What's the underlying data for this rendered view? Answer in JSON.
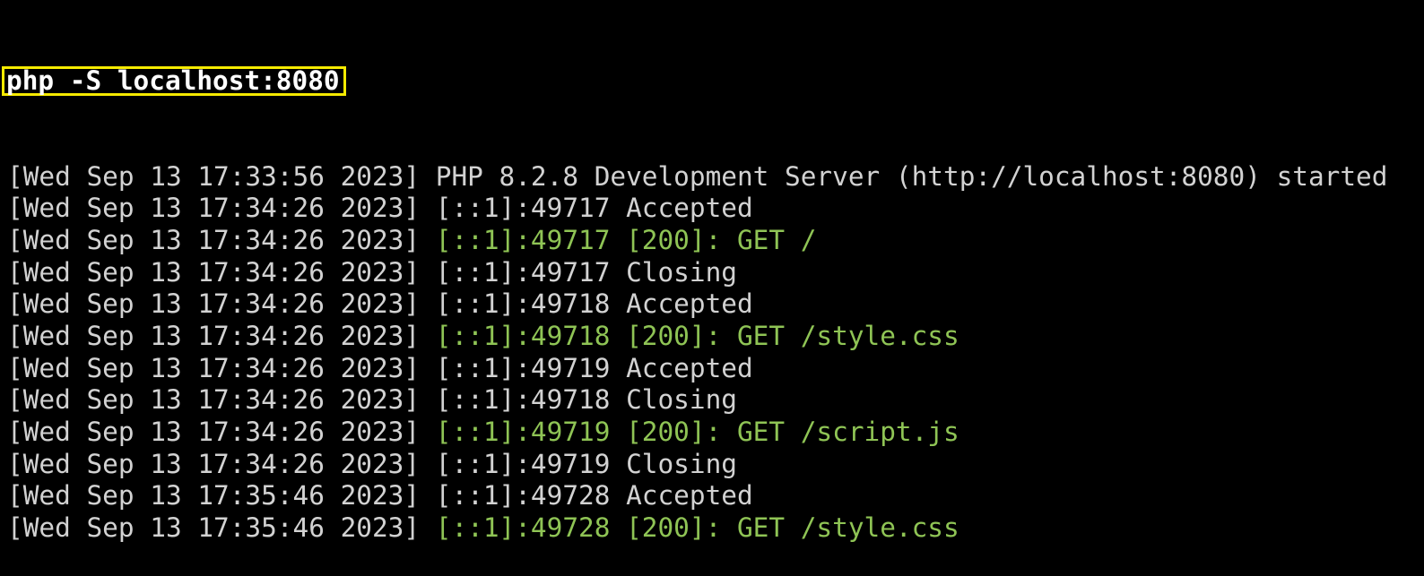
{
  "command": "php -S localhost:8080",
  "colors": {
    "highlight_border": "#f5ea00",
    "request_green": "#8fc455",
    "text": "#d2d2d2"
  },
  "log": [
    {
      "ts": "[Wed Sep 13 17:33:56 2023]",
      "msg": "PHP 8.2.8 Development Server (http://localhost:8080) started",
      "green": false
    },
    {
      "ts": "[Wed Sep 13 17:34:26 2023]",
      "msg": "[::1]:49717 Accepted",
      "green": false
    },
    {
      "ts": "[Wed Sep 13 17:34:26 2023]",
      "msg": "[::1]:49717 [200]: GET /",
      "green": true
    },
    {
      "ts": "[Wed Sep 13 17:34:26 2023]",
      "msg": "[::1]:49717 Closing",
      "green": false
    },
    {
      "ts": "[Wed Sep 13 17:34:26 2023]",
      "msg": "[::1]:49718 Accepted",
      "green": false
    },
    {
      "ts": "[Wed Sep 13 17:34:26 2023]",
      "msg": "[::1]:49718 [200]: GET /style.css",
      "green": true
    },
    {
      "ts": "[Wed Sep 13 17:34:26 2023]",
      "msg": "[::1]:49719 Accepted",
      "green": false
    },
    {
      "ts": "[Wed Sep 13 17:34:26 2023]",
      "msg": "[::1]:49718 Closing",
      "green": false
    },
    {
      "ts": "[Wed Sep 13 17:34:26 2023]",
      "msg": "[::1]:49719 [200]: GET /script.js",
      "green": true
    },
    {
      "ts": "[Wed Sep 13 17:34:26 2023]",
      "msg": "[::1]:49719 Closing",
      "green": false
    },
    {
      "ts": "[Wed Sep 13 17:35:46 2023]",
      "msg": "[::1]:49728 Accepted",
      "green": false
    },
    {
      "ts": "[Wed Sep 13 17:35:46 2023]",
      "msg": "[::1]:49728 [200]: GET /style.css",
      "green": true
    }
  ]
}
